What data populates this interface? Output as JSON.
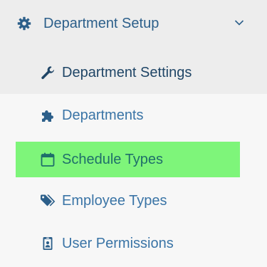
{
  "section": {
    "title": "Department Setup",
    "icon": "gear-icon",
    "expanded": true
  },
  "items": [
    {
      "label": "Department Settings",
      "icon": "wrench-icon",
      "state": "current"
    },
    {
      "label": "Departments",
      "icon": "puzzle-icon",
      "state": "normal"
    },
    {
      "label": "Schedule Types",
      "icon": "calendar-icon",
      "state": "active"
    },
    {
      "label": "Employee Types",
      "icon": "tags-icon",
      "state": "normal"
    },
    {
      "label": "User Permissions",
      "icon": "id-badge-icon",
      "state": "normal"
    }
  ],
  "colors": {
    "header_bg": "#ededed",
    "page_bg": "#f7f7f7",
    "active_bg": "#7ef57a",
    "link": "#3a74a6",
    "icon": "#2c5f8a"
  }
}
